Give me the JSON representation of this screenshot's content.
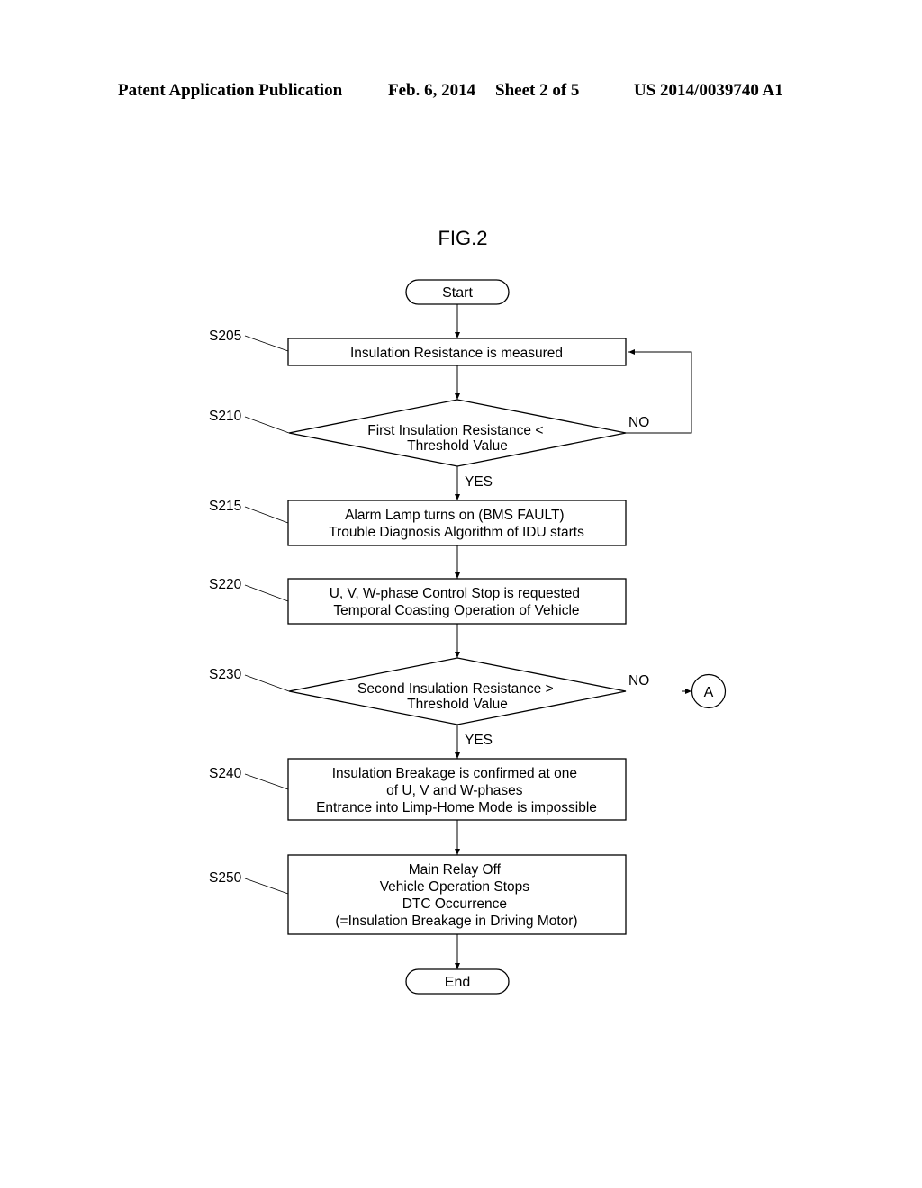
{
  "header": {
    "publication": "Patent Application Publication",
    "date": "Feb. 6, 2014",
    "sheet": "Sheet 2 of 5",
    "number": "US 2014/0039740 A1"
  },
  "figure": {
    "title": "FIG.2",
    "start": "Start",
    "end": "End",
    "connector": "A",
    "steps": [
      {
        "id": "S205",
        "type": "process",
        "lines": [
          "Insulation Resistance is measured"
        ]
      },
      {
        "id": "S210",
        "type": "decision",
        "lines": [
          "First Insulation Resistance <",
          "Threshold Value"
        ],
        "yes": "YES",
        "no": "NO"
      },
      {
        "id": "S215",
        "type": "process",
        "lines": [
          "Alarm Lamp turns on (BMS FAULT)",
          "Trouble Diagnosis Algorithm of IDU starts"
        ]
      },
      {
        "id": "S220",
        "type": "process",
        "lines": [
          "U, V, W-phase Control Stop is requested",
          "Temporal Coasting Operation of Vehicle"
        ]
      },
      {
        "id": "S230",
        "type": "decision",
        "lines": [
          "Second Insulation Resistance >",
          "Threshold Value"
        ],
        "yes": "YES",
        "no": "NO"
      },
      {
        "id": "S240",
        "type": "process",
        "lines": [
          "Insulation Breakage is confirmed at one",
          "of U, V and W-phases",
          "Entrance into Limp-Home Mode is impossible"
        ]
      },
      {
        "id": "S250",
        "type": "process",
        "lines": [
          "Main Relay Off",
          "Vehicle Operation Stops",
          "DTC Occurrence",
          "(=Insulation Breakage in Driving Motor)"
        ]
      }
    ]
  }
}
